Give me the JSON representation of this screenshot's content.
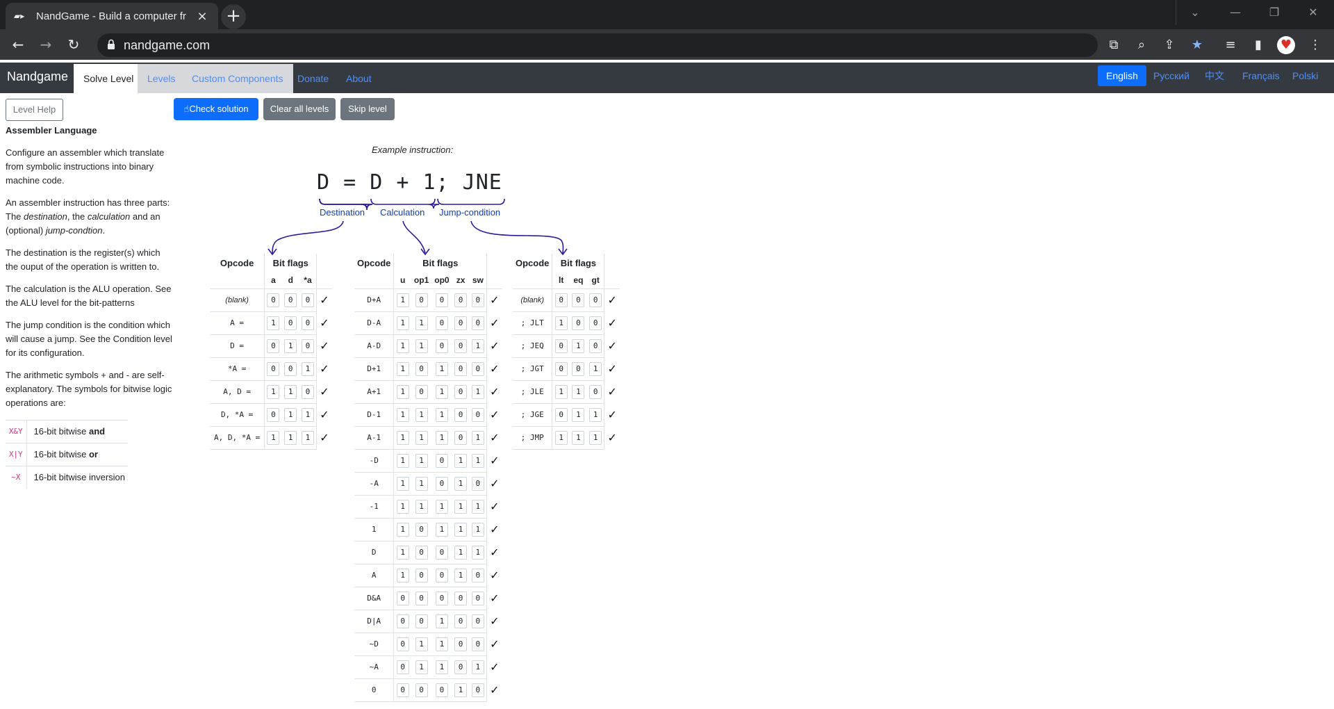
{
  "browser": {
    "tab_title": "NandGame - Build a computer fr",
    "url": "nandgame.com"
  },
  "navbar": {
    "brand": "Nandgame",
    "items": [
      "Solve Level",
      "Levels",
      "Custom Components",
      "Donate",
      "About"
    ],
    "languages": [
      "English",
      "Русский",
      "中文",
      "Français",
      "Polski"
    ]
  },
  "help": {
    "button": "Level Help",
    "title": "Assembler Language",
    "p1": "Configure an assembler which translate from symbolic instructions into binary machine code.",
    "p2_a": "An assembler instruction has three parts: The ",
    "p2_dest": "destination",
    "p2_b": ", the ",
    "p2_calc": "calculation",
    "p2_c": " and an (optional) ",
    "p2_jump": "jump-condtion",
    "p2_d": ".",
    "p3": "The destination is the register(s) which the ouput of the operation is written to.",
    "p4": "The calculation is the ALU operation. See the ALU level for the bit-patterns",
    "p5": "The jump condition is the condition which will cause a jump. See the Condition level for its configuration.",
    "p6": "The arithmetic symbols + and - are self-explanatory. The symbols for bitwise logic operations are:",
    "symbols": [
      {
        "sym": "X&Y",
        "pre": "16-bit bitwise ",
        "bold": "and"
      },
      {
        "sym": "X|Y",
        "pre": "16-bit bitwise ",
        "bold": "or"
      },
      {
        "sym": "~X",
        "pre": "16-bit bitwise inversion",
        "bold": ""
      }
    ]
  },
  "actions": {
    "check": "Check solution",
    "clear": "Clear all levels",
    "skip": "Skip level"
  },
  "example": {
    "label": "Example instruction:",
    "instruction": "D = D + 1; JNE",
    "parts": [
      "Destination",
      "Calculation",
      "Jump-condition"
    ]
  },
  "dest_table": {
    "opcode_header": "Opcode",
    "bits_header": "Bit flags",
    "flags": [
      "a",
      "d",
      "*a"
    ],
    "rows": [
      {
        "op": "(blank)",
        "bits": [
          "0",
          "0",
          "0"
        ]
      },
      {
        "op": "A =",
        "bits": [
          "1",
          "0",
          "0"
        ]
      },
      {
        "op": "D =",
        "bits": [
          "0",
          "1",
          "0"
        ]
      },
      {
        "op": "*A =",
        "bits": [
          "0",
          "0",
          "1"
        ]
      },
      {
        "op": "A, D =",
        "bits": [
          "1",
          "1",
          "0"
        ]
      },
      {
        "op": "D, *A =",
        "bits": [
          "0",
          "1",
          "1"
        ]
      },
      {
        "op": "A, D, *A =",
        "bits": [
          "1",
          "1",
          "1"
        ]
      }
    ]
  },
  "calc_table": {
    "opcode_header": "Opcode",
    "bits_header": "Bit flags",
    "flags": [
      "u",
      "op1",
      "op0",
      "zx",
      "sw"
    ],
    "rows": [
      {
        "op": "D+A",
        "bits": [
          "1",
          "0",
          "0",
          "0",
          "0"
        ]
      },
      {
        "op": "D-A",
        "bits": [
          "1",
          "1",
          "0",
          "0",
          "0"
        ]
      },
      {
        "op": "A-D",
        "bits": [
          "1",
          "1",
          "0",
          "0",
          "1"
        ]
      },
      {
        "op": "D+1",
        "bits": [
          "1",
          "0",
          "1",
          "0",
          "0"
        ]
      },
      {
        "op": "A+1",
        "bits": [
          "1",
          "0",
          "1",
          "0",
          "1"
        ]
      },
      {
        "op": "D-1",
        "bits": [
          "1",
          "1",
          "1",
          "0",
          "0"
        ]
      },
      {
        "op": "A-1",
        "bits": [
          "1",
          "1",
          "1",
          "0",
          "1"
        ]
      },
      {
        "op": "-D",
        "bits": [
          "1",
          "1",
          "0",
          "1",
          "1"
        ]
      },
      {
        "op": "-A",
        "bits": [
          "1",
          "1",
          "0",
          "1",
          "0"
        ]
      },
      {
        "op": "-1",
        "bits": [
          "1",
          "1",
          "1",
          "1",
          "1"
        ]
      },
      {
        "op": "1",
        "bits": [
          "1",
          "0",
          "1",
          "1",
          "1"
        ]
      },
      {
        "op": "D",
        "bits": [
          "1",
          "0",
          "0",
          "1",
          "1"
        ]
      },
      {
        "op": "A",
        "bits": [
          "1",
          "0",
          "0",
          "1",
          "0"
        ]
      },
      {
        "op": "D&A",
        "bits": [
          "0",
          "0",
          "0",
          "0",
          "0"
        ]
      },
      {
        "op": "D|A",
        "bits": [
          "0",
          "0",
          "1",
          "0",
          "0"
        ]
      },
      {
        "op": "~D",
        "bits": [
          "0",
          "1",
          "1",
          "0",
          "0"
        ]
      },
      {
        "op": "~A",
        "bits": [
          "0",
          "1",
          "1",
          "0",
          "1"
        ]
      },
      {
        "op": "0",
        "bits": [
          "0",
          "0",
          "0",
          "1",
          "0"
        ]
      }
    ]
  },
  "jump_table": {
    "opcode_header": "Opcode",
    "bits_header": "Bit flags",
    "flags": [
      "lt",
      "eq",
      "gt"
    ],
    "rows": [
      {
        "op": "(blank)",
        "bits": [
          "0",
          "0",
          "0"
        ]
      },
      {
        "op": "; JLT",
        "bits": [
          "1",
          "0",
          "0"
        ]
      },
      {
        "op": "; JEQ",
        "bits": [
          "0",
          "1",
          "0"
        ]
      },
      {
        "op": "; JGT",
        "bits": [
          "0",
          "0",
          "1"
        ]
      },
      {
        "op": "; JLE",
        "bits": [
          "1",
          "1",
          "0"
        ]
      },
      {
        "op": "; JGE",
        "bits": [
          "0",
          "1",
          "1"
        ]
      },
      {
        "op": "; JMP",
        "bits": [
          "1",
          "1",
          "1"
        ]
      }
    ]
  },
  "check_mark": "✓",
  "colors": {
    "navbar": "#343a40",
    "primary": "#0d6efd",
    "secondary": "#6c757d",
    "link": "#4d8eff",
    "brace": "#2b1a9e"
  }
}
